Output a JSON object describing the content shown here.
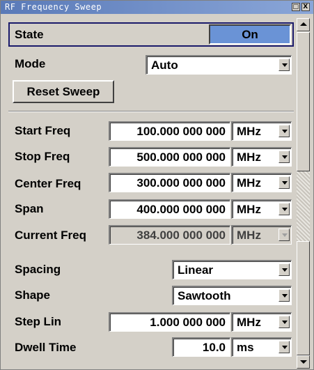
{
  "window": {
    "title": "RF Frequency Sweep",
    "buttons": {
      "restore": "□",
      "close": "X"
    }
  },
  "state": {
    "label": "State",
    "value": "On"
  },
  "mode": {
    "label": "Mode",
    "value": "Auto"
  },
  "reset_button": {
    "label": "Reset Sweep"
  },
  "fields": {
    "start_freq": {
      "label": "Start Freq",
      "value": "100.000 000 000",
      "unit": "MHz"
    },
    "stop_freq": {
      "label": "Stop Freq",
      "value": "500.000 000 000",
      "unit": "MHz"
    },
    "center_freq": {
      "label": "Center Freq",
      "value": "300.000 000 000",
      "unit": "MHz"
    },
    "span": {
      "label": "Span",
      "value": "400.000 000 000",
      "unit": "MHz"
    },
    "current_freq": {
      "label": "Current Freq",
      "value": "384.000 000 000",
      "unit": "MHz"
    },
    "step_lin": {
      "label": "Step Lin",
      "value": "1.000 000 000",
      "unit": "MHz"
    },
    "dwell_time": {
      "label": "Dwell Time",
      "value": "10.0",
      "unit": "ms"
    }
  },
  "spacing": {
    "label": "Spacing",
    "value": "Linear"
  },
  "shape": {
    "label": "Shape",
    "value": "Sawtooth"
  },
  "colors": {
    "title_bar": "#5a7ab8",
    "state_on_bg": "#6a93d6",
    "panel_bg": "#d4d0c8"
  }
}
